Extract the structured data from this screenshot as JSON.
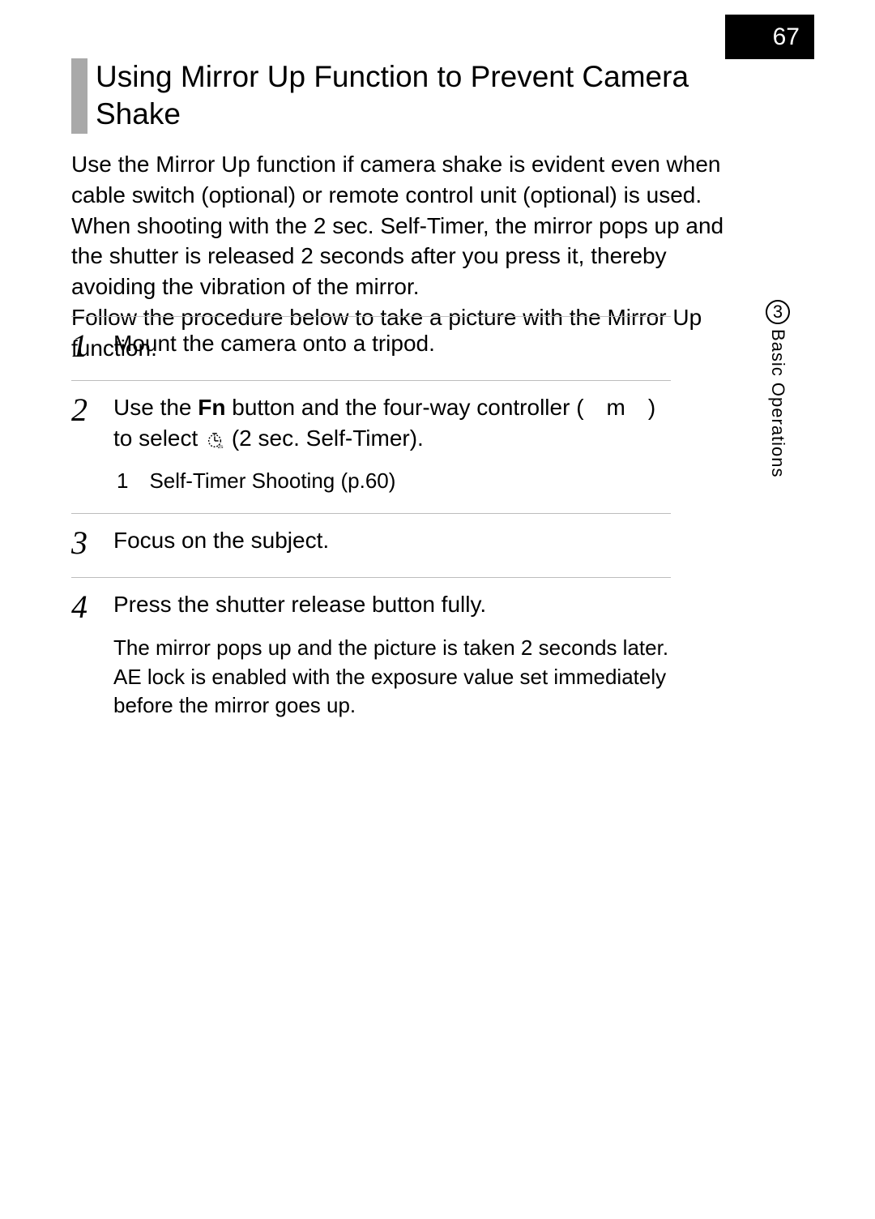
{
  "page_number": "67",
  "title": "Using Mirror Up Function to Prevent Camera Shake",
  "intro": "Use the Mirror Up function if camera shake is evident even when cable switch (optional) or remote control unit (optional) is used.\nWhen shooting with the 2 sec. Self-Timer, the mirror pops up and the shutter is released 2 seconds after you press it, thereby avoiding the vibration of the mirror.\nFollow the procedure below to take a picture with the Mirror Up function.",
  "steps": [
    {
      "num": "1",
      "line_pre": "Mount the camera onto a tripod.",
      "fn": "",
      "line_mid": "",
      "line_post": "",
      "cross_ref": "",
      "detail": ""
    },
    {
      "num": "2",
      "line_pre": "Use the ",
      "fn": "Fn",
      "line_mid": " button and the four-way controller ( m ) to select ",
      "line_post": " (2 sec. Self-Timer).",
      "cross_ref": "1 Self-Timer Shooting (p.60)",
      "detail": ""
    },
    {
      "num": "3",
      "line_pre": "Focus on the subject.",
      "fn": "",
      "line_mid": "",
      "line_post": "",
      "cross_ref": "",
      "detail": ""
    },
    {
      "num": "4",
      "line_pre": "Press the shutter release button fully.",
      "fn": "",
      "line_mid": "",
      "line_post": "",
      "cross_ref": "",
      "detail": "The mirror pops up and the picture is taken 2 seconds later. AE lock is enabled with the exposure value set immediately before the mirror goes up."
    }
  ],
  "side": {
    "chapter_num": "3",
    "chapter_label": "Basic Operations"
  },
  "icons": {
    "timer": "self-timer-2s-icon"
  }
}
